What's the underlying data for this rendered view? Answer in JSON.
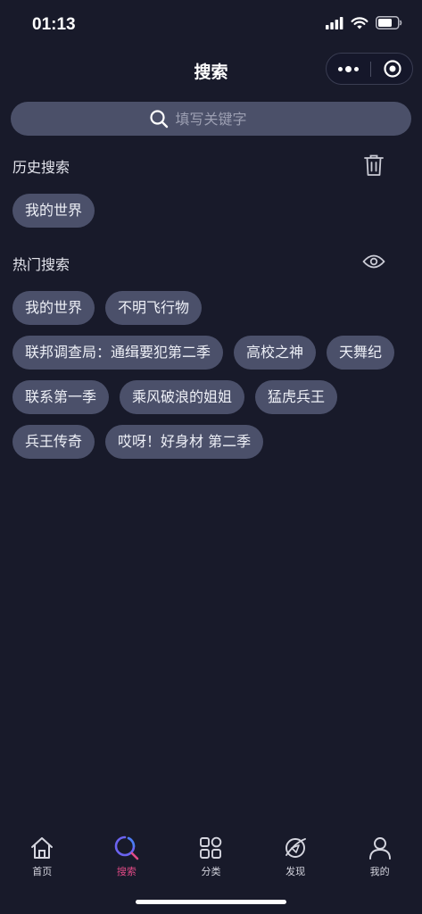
{
  "status_bar": {
    "time": "01:13"
  },
  "header": {
    "title": "搜索"
  },
  "search": {
    "placeholder": "填写关键字",
    "value": ""
  },
  "history": {
    "title": "历史搜索",
    "action_icon": "trash-icon",
    "tags": [
      "我的世界"
    ]
  },
  "hot": {
    "title": "热门搜索",
    "action_icon": "eye-icon",
    "tags": [
      "我的世界",
      "不明飞行物",
      "联邦调查局：通缉要犯第二季",
      "高校之神",
      "天舞纪",
      "联系第一季",
      "乘风破浪的姐姐",
      "猛虎兵王",
      "兵王传奇",
      "哎呀！好身材 第二季"
    ]
  },
  "tab_bar": {
    "active_color": "#e04a86",
    "items": [
      {
        "label": "首页",
        "icon": "home-icon"
      },
      {
        "label": "搜索",
        "icon": "search-icon",
        "active": true
      },
      {
        "label": "分类",
        "icon": "category-icon"
      },
      {
        "label": "发现",
        "icon": "discover-icon"
      },
      {
        "label": "我的",
        "icon": "profile-icon"
      }
    ]
  },
  "colors": {
    "background": "#181a2a",
    "tag_background": "#4b506a",
    "search_background": "#4b5069"
  }
}
